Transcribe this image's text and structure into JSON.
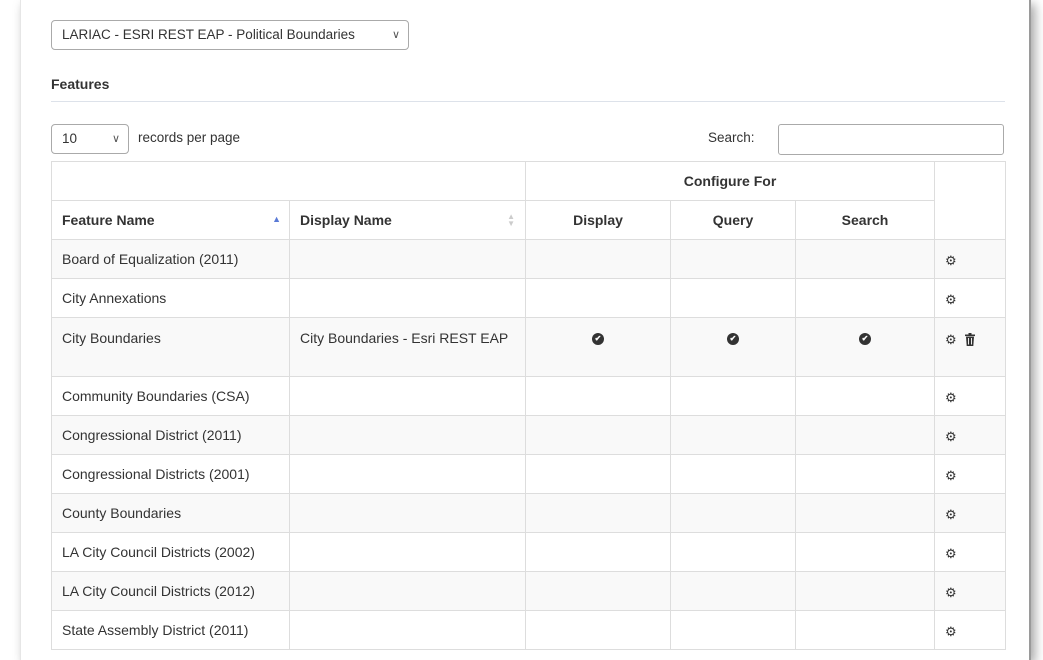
{
  "source": {
    "selected": "LARIAC - ESRI REST EAP - Political Boundaries"
  },
  "features": {
    "title": "Features"
  },
  "table_controls": {
    "page_length": "10",
    "page_length_suffix": "records per page",
    "search_label": "Search:",
    "search_value": ""
  },
  "table": {
    "group_header": "Configure For",
    "columns": {
      "feature_name": "Feature Name",
      "display_name": "Display Name",
      "display": "Display",
      "query": "Query",
      "search": "Search"
    },
    "rows": [
      {
        "feature": "Board of Equalization (2011)",
        "display_name": "",
        "display": false,
        "query": false,
        "search": false,
        "deletable": false
      },
      {
        "feature": "City Annexations",
        "display_name": "",
        "display": false,
        "query": false,
        "search": false,
        "deletable": false
      },
      {
        "feature": "City Boundaries",
        "display_name": "City Boundaries - Esri REST EAP",
        "display": true,
        "query": true,
        "search": true,
        "deletable": true
      },
      {
        "feature": "Community Boundaries (CSA)",
        "display_name": "",
        "display": false,
        "query": false,
        "search": false,
        "deletable": false
      },
      {
        "feature": "Congressional District (2011)",
        "display_name": "",
        "display": false,
        "query": false,
        "search": false,
        "deletable": false
      },
      {
        "feature": "Congressional Districts (2001)",
        "display_name": "",
        "display": false,
        "query": false,
        "search": false,
        "deletable": false
      },
      {
        "feature": "County Boundaries",
        "display_name": "",
        "display": false,
        "query": false,
        "search": false,
        "deletable": false
      },
      {
        "feature": "LA City Council Districts (2002)",
        "display_name": "",
        "display": false,
        "query": false,
        "search": false,
        "deletable": false
      },
      {
        "feature": "LA City Council Districts (2012)",
        "display_name": "",
        "display": false,
        "query": false,
        "search": false,
        "deletable": false
      },
      {
        "feature": "State Assembly District (2011)",
        "display_name": "",
        "display": false,
        "query": false,
        "search": false,
        "deletable": false
      }
    ]
  },
  "icons": {
    "configure": "gear-icon",
    "delete": "trash-icon",
    "enabled": "check-circle-icon",
    "sort_asc": "sort-asc-icon",
    "sort_both": "sort-both-icon",
    "dropdown": "chevron-down-icon"
  },
  "colors": {
    "sort_active": "#5a7ad6",
    "row_stripe": "#f9f9f9",
    "border": "#dddddd"
  }
}
